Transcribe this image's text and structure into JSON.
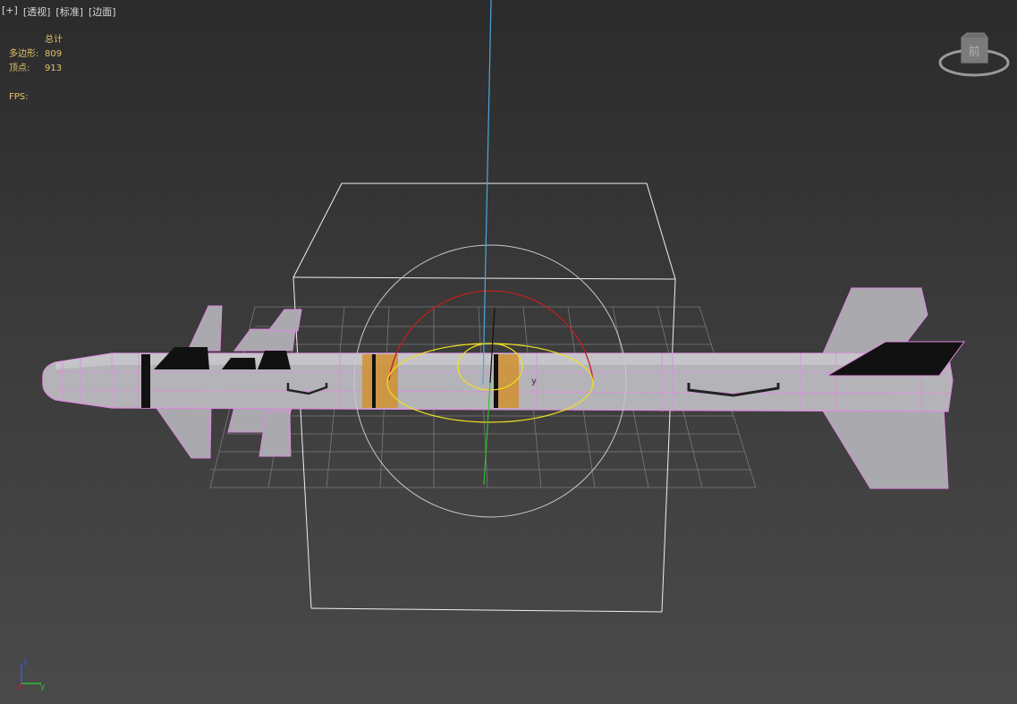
{
  "viewport": {
    "plus": "[+]",
    "view": "[透视]",
    "shading": "[标准]",
    "mode": "[边面]"
  },
  "stats": {
    "header": "总计",
    "polygons_label": "多边形:",
    "polygons_value": "809",
    "vertices_label": "顶点:",
    "vertices_value": "913",
    "fps_label": "FPS:"
  },
  "viewcube": {
    "face": "前"
  },
  "gizmo": {
    "axis_y": "y",
    "axis_z": "z"
  },
  "colors": {
    "wire": "#e08ae0",
    "body": "#b8b8bc",
    "band": "#d09030",
    "gizmo_blue": "#4aa8e0",
    "gizmo_green": "#30c030",
    "gizmo_red": "#c02020",
    "gizmo_yellow": "#f0e020"
  }
}
